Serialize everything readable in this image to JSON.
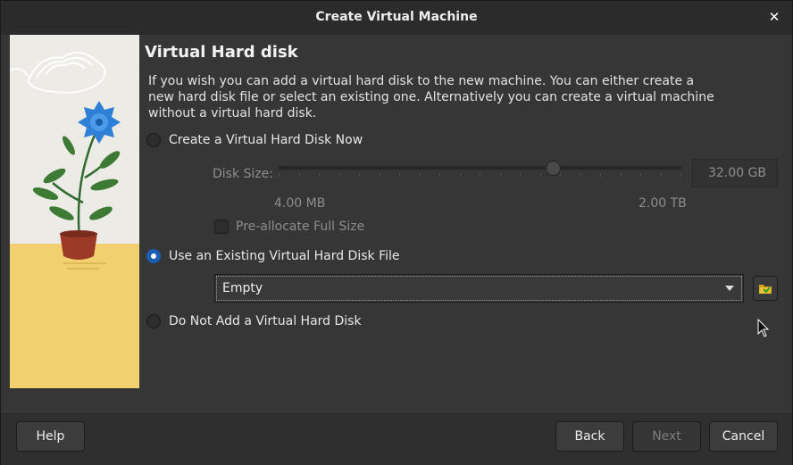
{
  "window": {
    "title": "Create Virtual Machine",
    "close_glyph": "✕"
  },
  "page": {
    "heading": "Virtual Hard disk",
    "description": "If you wish you can add a virtual hard disk to the new machine. You can either create a new hard disk file or select an existing one. Alternatively you can create a virtual machine without a virtual hard disk."
  },
  "options": {
    "create_now": {
      "label": "Create a Virtual Hard Disk Now",
      "selected": false
    },
    "use_existing": {
      "label": "Use an Existing Virtual Hard Disk File",
      "selected": true
    },
    "none": {
      "label": "Do Not Add a Virtual Hard Disk",
      "selected": false
    }
  },
  "disk_size": {
    "label": "Disk Size:",
    "value": "32.00 GB",
    "min_label": "4.00 MB",
    "max_label": "2.00 TB",
    "slider_fraction": 0.68
  },
  "preallocate": {
    "label": "Pre-allocate Full Size",
    "checked": false
  },
  "existing_file": {
    "selected": "Empty",
    "choose_icon": "folder-open-icon"
  },
  "footer": {
    "help": "Help",
    "back": "Back",
    "next": "Next",
    "cancel": "Cancel"
  },
  "colors": {
    "accent": "#1a5fb4",
    "background": "#363636",
    "titlebar": "#2b2b2b"
  }
}
